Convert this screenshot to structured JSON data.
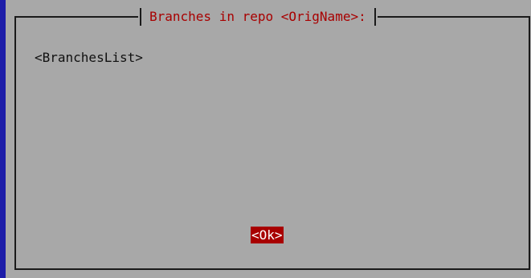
{
  "dialog": {
    "title": "Branches in repo <OrigName>:",
    "body_text": "<BranchesList>",
    "ok_label": "<Ok>"
  },
  "colors": {
    "screen_background": "#1c1ca8",
    "dialog_background": "#a8a8a8",
    "title_text": "#a80000",
    "button_background": "#a80000",
    "button_text": "#ffffff"
  }
}
